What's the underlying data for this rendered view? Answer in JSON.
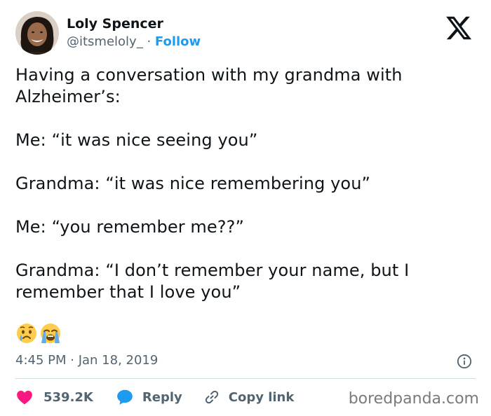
{
  "author": {
    "display_name": "Loly Spencer",
    "handle": "@itsmeloly_",
    "separator": " · ",
    "follow_label": "Follow"
  },
  "tweet": {
    "paragraphs": [
      "Having a conversation with my grandma with Alzheimer’s:",
      "Me: “it was nice seeing you”",
      "Grandma: “it was nice remembering you”",
      "Me: “you remember me??”",
      "Grandma: “I don’t remember your name, but I remember that I love you”"
    ],
    "timestamp": "4:45 PM · Jan 18, 2019"
  },
  "actions": {
    "likes_count": "539.2K",
    "reply_label": "Reply",
    "copy_link_label": "Copy link"
  },
  "watermark": "boredpanda.com",
  "colors": {
    "accent": "#1d9bf0",
    "like": "#f91880",
    "secondary_text": "#536471"
  },
  "icons": [
    "x-logo-icon",
    "info-icon",
    "heart-icon",
    "reply-bubble-icon",
    "link-icon",
    "crying-face-emoji",
    "loudly-crying-face-emoji"
  ]
}
